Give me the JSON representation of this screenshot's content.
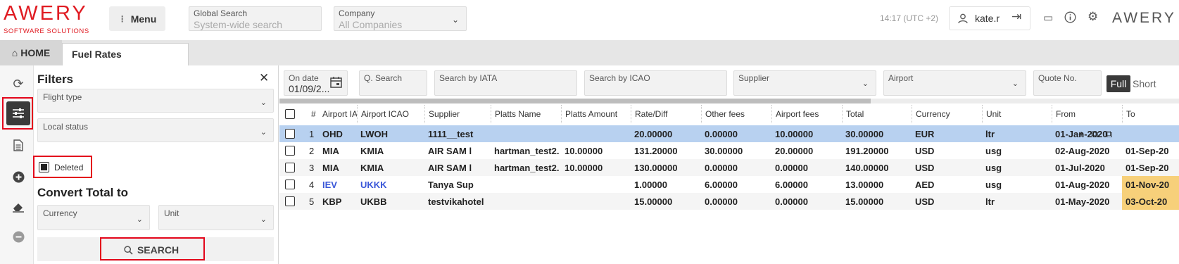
{
  "header": {
    "logo_word": "AWERY",
    "logo_sub": "SOFTWARE SOLUTIONS",
    "menu_label": "Menu",
    "global_search": {
      "label": "Global Search",
      "placeholder": "System-wide search"
    },
    "company": {
      "label": "Company",
      "value": "All Companies"
    },
    "time": "14:17 (UTC +2)",
    "user": "kate.r",
    "right_logo": "AWERY"
  },
  "tabs": {
    "home": "HOME",
    "active": "Fuel Rates"
  },
  "filters": {
    "title": "Filters",
    "close": "✕",
    "flight_type": "Flight type",
    "local_status": "Local status",
    "deleted_label": "Deleted",
    "deleted_checked": true,
    "convert_title": "Convert Total to",
    "currency": "Currency",
    "unit": "Unit",
    "search_label": "SEARCH"
  },
  "toolbar": {
    "on_date": {
      "label": "On date",
      "value": "01/09/2..."
    },
    "q_search": "Q. Search",
    "iata": "Search by IATA",
    "icao": "Search by ICAO",
    "supplier": "Supplier",
    "airport": "Airport",
    "quote_no": "Quote No.",
    "full": "Full",
    "short": "Short"
  },
  "table": {
    "columns": [
      "#",
      "Airport IATA",
      "Airport ICAO",
      "Supplier",
      "Platts Name",
      "Platts Amount",
      "Rate/Diff",
      "Other fees",
      "Airport fees",
      "Total",
      "Currency",
      "Unit",
      "From",
      "To"
    ],
    "rows": [
      {
        "n": "1",
        "iata": "OHD",
        "icao": "LWOH",
        "supplier": "1111__test",
        "platts_name": "",
        "platts_amount": "",
        "rate": "20.00000",
        "other": "0.00000",
        "airport_fees": "10.00000",
        "total": "30.00000",
        "currency": "EUR",
        "unit": "ltr",
        "from": "01-Jan-2020",
        "to": ""
      },
      {
        "n": "2",
        "iata": "MIA",
        "icao": "KMIA",
        "supplier": "AIR SAM l",
        "platts_name": "hartman_test2.",
        "platts_amount": "10.00000",
        "rate": "131.20000",
        "other": "30.00000",
        "airport_fees": "20.00000",
        "total": "191.20000",
        "currency": "USD",
        "unit": "usg",
        "from": "02-Aug-2020",
        "to": "01-Sep-20"
      },
      {
        "n": "3",
        "iata": "MIA",
        "icao": "KMIA",
        "supplier": "AIR SAM l",
        "platts_name": "hartman_test2.",
        "platts_amount": "10.00000",
        "rate": "130.00000",
        "other": "0.00000",
        "airport_fees": "0.00000",
        "total": "140.00000",
        "currency": "USD",
        "unit": "usg",
        "from": "01-Jul-2020",
        "to": "01-Sep-20"
      },
      {
        "n": "4",
        "iata": "IEV",
        "icao": "UKKK",
        "supplier": "Tanya Sup",
        "platts_name": "",
        "platts_amount": "",
        "rate": "1.00000",
        "other": "6.00000",
        "airport_fees": "6.00000",
        "total": "13.00000",
        "currency": "AED",
        "unit": "usg",
        "from": "01-Aug-2020",
        "to": "01-Nov-20"
      },
      {
        "n": "5",
        "iata": "KBP",
        "icao": "UKBB",
        "supplier": "testvikahotel",
        "platts_name": "",
        "platts_amount": "",
        "rate": "15.00000",
        "other": "0.00000",
        "airport_fees": "0.00000",
        "total": "15.00000",
        "currency": "USD",
        "unit": "ltr",
        "from": "01-May-2020",
        "to": "03-Oct-20"
      }
    ]
  },
  "colors": {
    "brand": "#e01b22",
    "selected_row": "#b8d1f0",
    "highlight": "#e3061b",
    "expired": "#f7d07a",
    "link": "#3a57d8"
  },
  "icons": [
    "refresh-icon",
    "sliders-icon",
    "document-icon",
    "plus-circle-icon",
    "eraser-icon",
    "minus-circle-icon",
    "search-icon",
    "calendar-icon",
    "user-icon",
    "logout-icon",
    "chat-icon",
    "info-icon",
    "gear-icon",
    "home-icon"
  ]
}
